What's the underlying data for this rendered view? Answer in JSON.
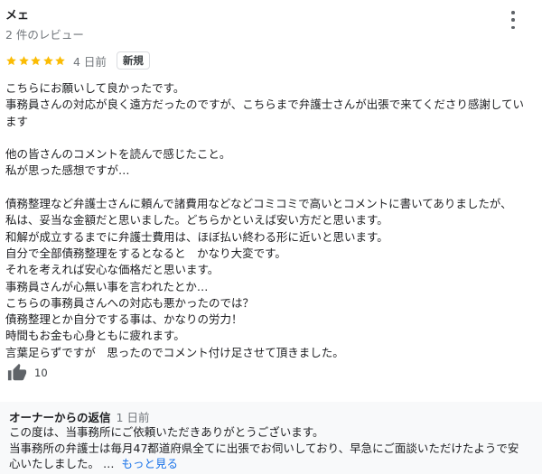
{
  "review": {
    "reviewer_name": "メェ",
    "review_count": "2 件のレビュー",
    "rating": 5,
    "rating_max": 5,
    "star_color": "#fbbc04",
    "date": "4 日前",
    "new_badge": "新規",
    "menu_icon": "more-vert-icon",
    "body_lines": [
      "こちらにお願いして良かったです。",
      "事務員さんの対応が良く遠方だったのですが、こちらまで弁護士さんが出張で来てくださり感謝してい",
      "ます",
      "",
      "他の皆さんのコメントを読んで感じたこと。",
      "私が思った感想ですが…",
      "",
      "債務整理など弁護士さんに頼んで諸費用などなどコミコミで高いとコメントに書いてありましたが、",
      "私は、妥当な金額だと思いました。どちらかといえば安い方だと思います。",
      "和解が成立するまでに弁護士費用は、ほぼ払い終わる形に近いと思います。",
      "自分で全部債務整理をするとなると　かなり大変です。",
      "それを考えれば安心な価格だと思います。",
      "事務員さんが心無い事を言われたとか…",
      "こちらの事務員さんへの対応も悪かったのでは？",
      "債務整理とか自分でする事は、かなりの労力！",
      "時間もお金も心身ともに疲れます。",
      "言葉足らずですが　思ったのでコメント付け足させて頂きました。"
    ],
    "like_icon": "thumbs-up-icon",
    "like_count": "10"
  },
  "owner_reply": {
    "label": "オーナーからの返信",
    "date": "1 日前",
    "text_lines": [
      "この度は、当事務所にご依頼いただきありがとうございます。",
      "当事務所の弁護士は毎月47都道府県全てに出張でお伺いしており、早急にご面談いただけたようで安",
      "心いたしました。 …"
    ],
    "more_link": "もっと見る",
    "link_color": "#1a73e8"
  }
}
